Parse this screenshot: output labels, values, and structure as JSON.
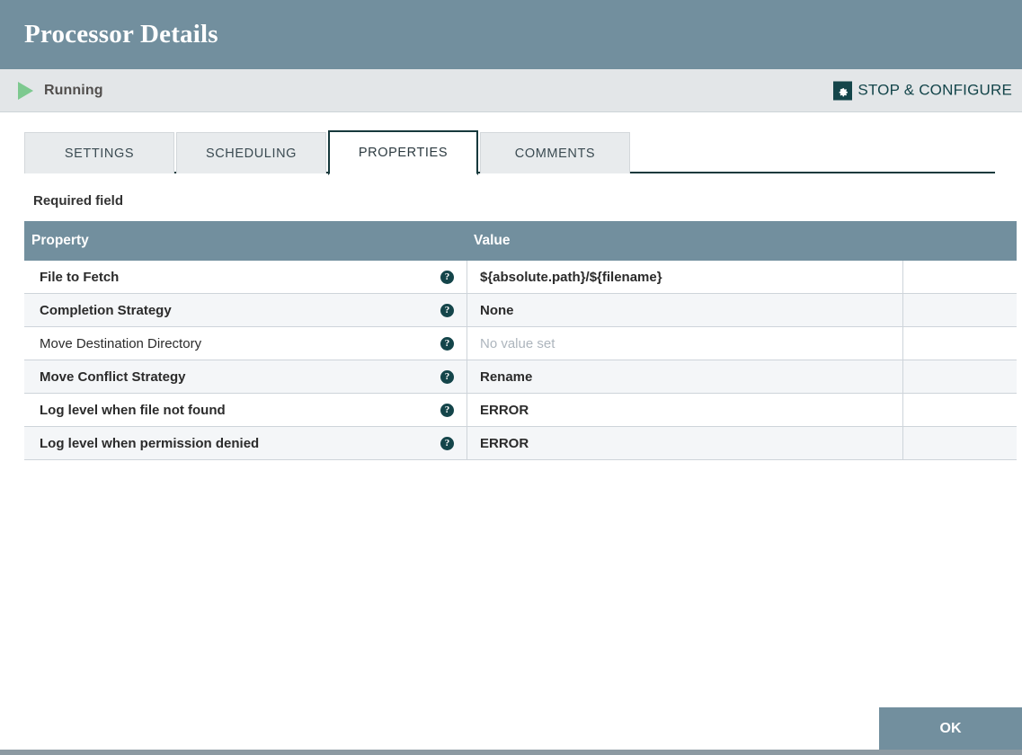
{
  "header": {
    "title": "Processor Details",
    "background": "#728f9e"
  },
  "status": {
    "run_state": "Running",
    "run_icon": "play-triangle-icon",
    "stop_configure_label": "STOP & CONFIGURE",
    "stop_configure_icon": "gear-icon",
    "accent": "#14454a",
    "running_color": "#7dc98f"
  },
  "tabs": [
    {
      "label": "SETTINGS",
      "active": false
    },
    {
      "label": "SCHEDULING",
      "active": false
    },
    {
      "label": "PROPERTIES",
      "active": true
    },
    {
      "label": "COMMENTS",
      "active": false
    }
  ],
  "main": {
    "required_field_note": "Required field",
    "table": {
      "columns": [
        "Property",
        "Value",
        ""
      ],
      "rows": [
        {
          "property": "File to Fetch",
          "required": true,
          "help_icon": "help-circle-icon",
          "value": "${absolute.path}/${filename}",
          "value_is_placeholder": false
        },
        {
          "property": "Completion Strategy",
          "required": true,
          "help_icon": "help-circle-icon",
          "value": "None",
          "value_is_placeholder": false
        },
        {
          "property": "Move Destination Directory",
          "required": false,
          "help_icon": "help-circle-icon",
          "value": "No value set",
          "value_is_placeholder": true
        },
        {
          "property": "Move Conflict Strategy",
          "required": true,
          "help_icon": "help-circle-icon",
          "value": "Rename",
          "value_is_placeholder": false
        },
        {
          "property": "Log level when file not found",
          "required": true,
          "help_icon": "help-circle-icon",
          "value": "ERROR",
          "value_is_placeholder": false
        },
        {
          "property": "Log level when permission denied",
          "required": true,
          "help_icon": "help-circle-icon",
          "value": "ERROR",
          "value_is_placeholder": false
        }
      ]
    }
  },
  "footer": {
    "ok_label": "OK"
  }
}
